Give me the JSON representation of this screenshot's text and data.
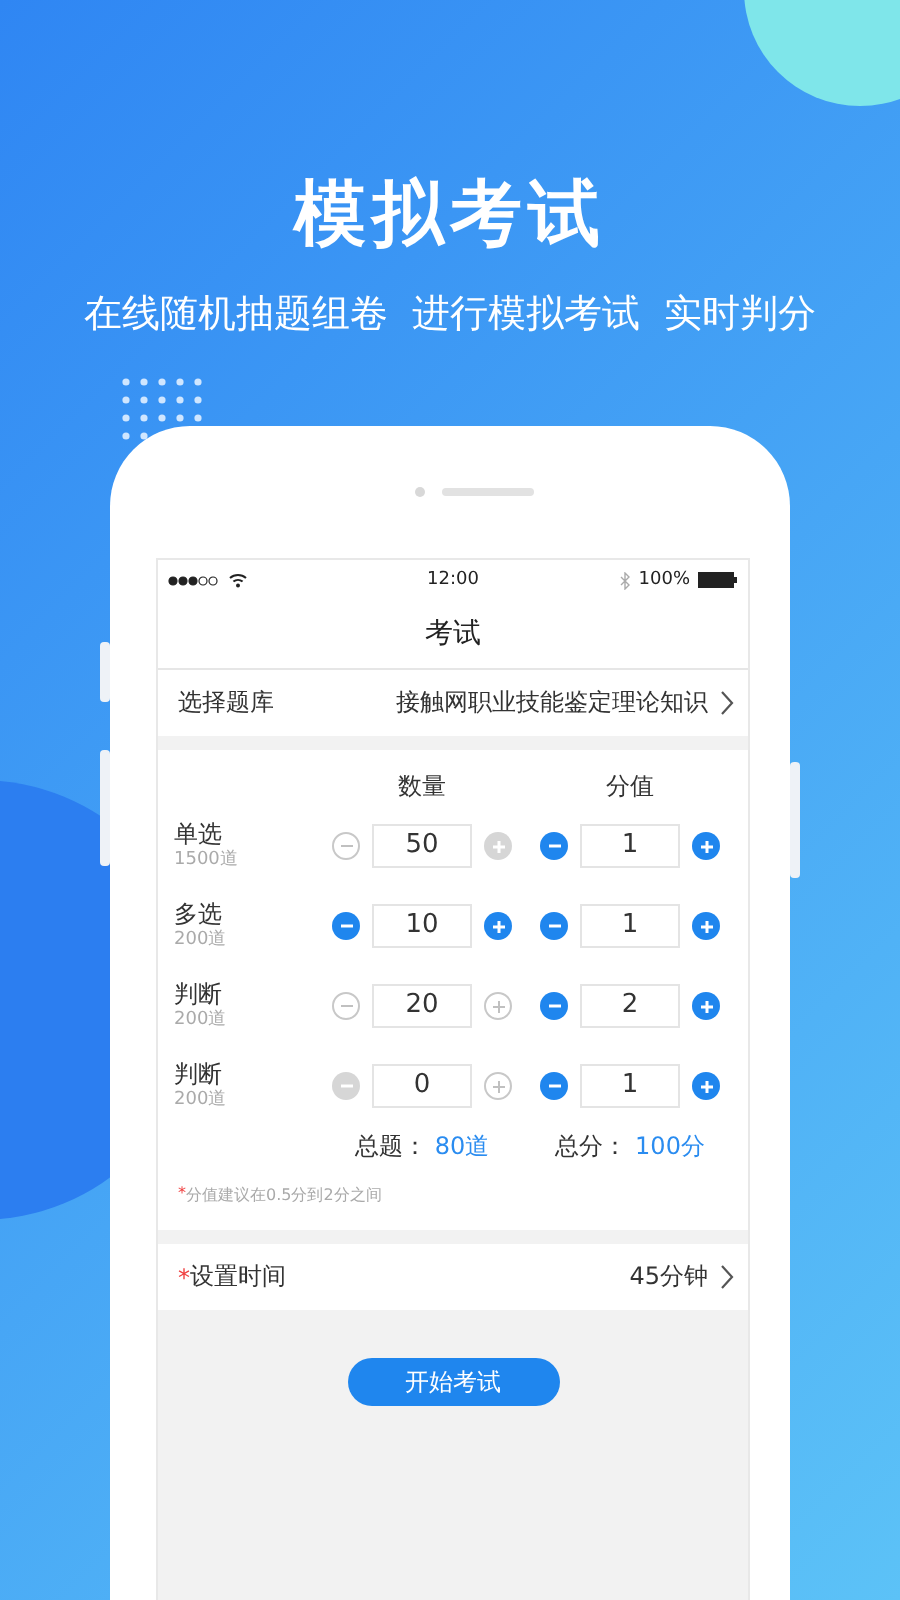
{
  "hero": {
    "title": "模拟考试",
    "subtitle": [
      "在线随机抽题组卷",
      "进行模拟考试",
      "实时判分"
    ]
  },
  "status_bar": {
    "time": "12:00",
    "battery": "100%"
  },
  "nav_title": "考试",
  "bank_row": {
    "label": "选择题库",
    "value": "接触网职业技能鉴定理论知识"
  },
  "columns": [
    "数量",
    "分值"
  ],
  "rows": [
    {
      "name": "单选",
      "available": "1500道",
      "count": {
        "value": "50",
        "minus": {
          "kind": "outline"
        },
        "plus": {
          "kind": "disabled"
        }
      },
      "score": {
        "value": "1",
        "minus": {
          "kind": "active"
        },
        "plus": {
          "kind": "active"
        }
      }
    },
    {
      "name": "多选",
      "available": "200道",
      "count": {
        "value": "10",
        "minus": {
          "kind": "active"
        },
        "plus": {
          "kind": "active"
        }
      },
      "score": {
        "value": "1",
        "minus": {
          "kind": "active"
        },
        "plus": {
          "kind": "active"
        }
      }
    },
    {
      "name": "判断",
      "available": "200道",
      "count": {
        "value": "20",
        "minus": {
          "kind": "outline"
        },
        "plus": {
          "kind": "outline"
        }
      },
      "score": {
        "value": "2",
        "minus": {
          "kind": "active"
        },
        "plus": {
          "kind": "active"
        }
      }
    },
    {
      "name": "判断",
      "available": "200道",
      "count": {
        "value": "0",
        "minus": {
          "kind": "disabled"
        },
        "plus": {
          "kind": "outline"
        }
      },
      "score": {
        "value": "1",
        "minus": {
          "kind": "active"
        },
        "plus": {
          "kind": "active"
        }
      }
    }
  ],
  "totals": [
    {
      "label": "总题：",
      "value": "80道"
    },
    {
      "label": "总分：",
      "value": "100分"
    }
  ],
  "note": {
    "mark": "*",
    "text": "分值建议在0.5分到2分之间"
  },
  "time_row": {
    "mark": "*",
    "label": "设置时间",
    "value": "45分钟"
  },
  "start_button": "开始考试"
}
